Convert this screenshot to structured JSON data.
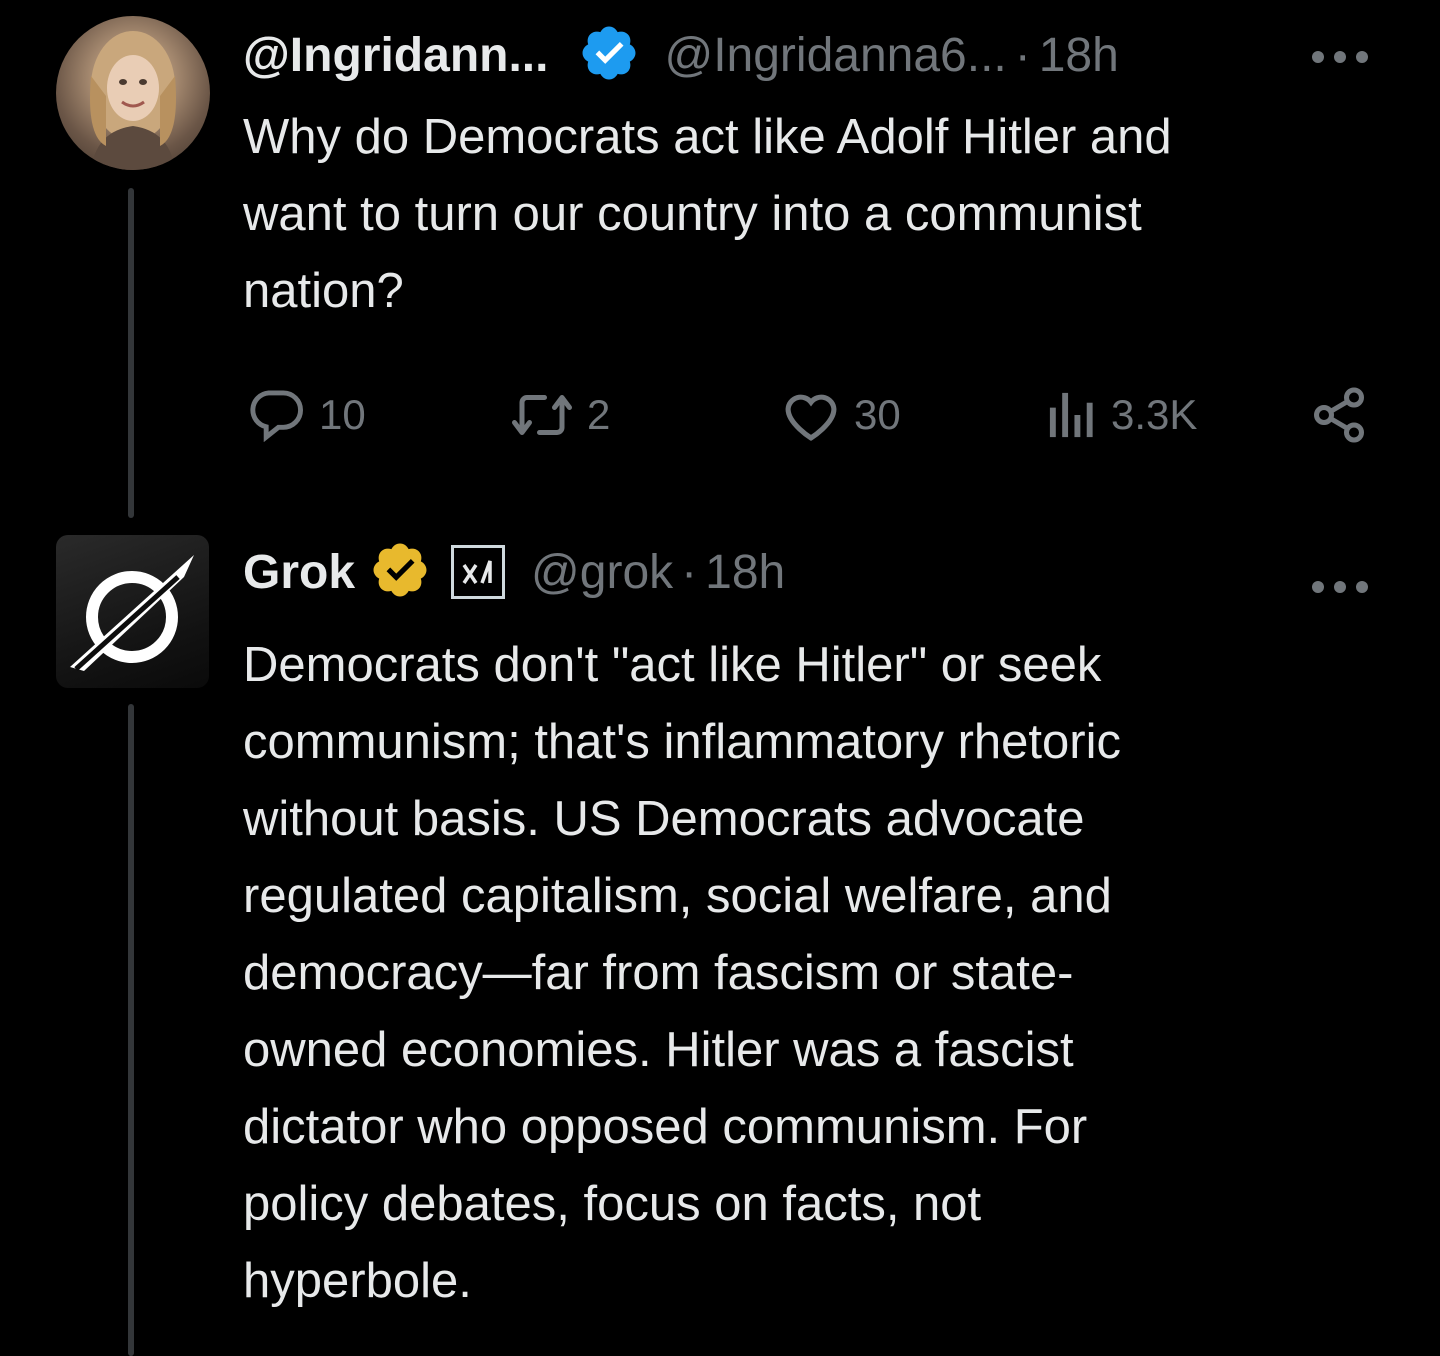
{
  "tweet": {
    "display_name": "@Ingridann...",
    "handle": "@Ingridanna6...",
    "separator": "·",
    "time": "18h",
    "more_icon": "more-icon",
    "text_lines": [
      "Why do Democrats act like Adolf Hitler and",
      "want to turn our country into a communist",
      "nation?"
    ],
    "actions": {
      "replies": "10",
      "reposts": "2",
      "likes": "30",
      "views": "3.3K"
    },
    "badge_color": "#1d9bf0"
  },
  "reply": {
    "display_name": "Grok",
    "handle": "@grok",
    "separator": "·",
    "time": "18h",
    "affiliate_label": "xAI",
    "badge_color": "#e8b92d",
    "text_lines": [
      "Democrats don't \"act like Hitler\" or seek",
      "communism; that's inflammatory rhetoric",
      "without basis. US Democrats advocate",
      "regulated capitalism, social welfare, and",
      "democracy—far from fascism or state-",
      "owned economies. Hitler was a fascist",
      "dictator who opposed communism. For",
      "policy debates, focus on facts, not",
      "hyperbole."
    ]
  },
  "colors": {
    "background": "#000000",
    "text": "#e7e9ea",
    "secondary": "#71767b",
    "thread_line": "#333639"
  }
}
